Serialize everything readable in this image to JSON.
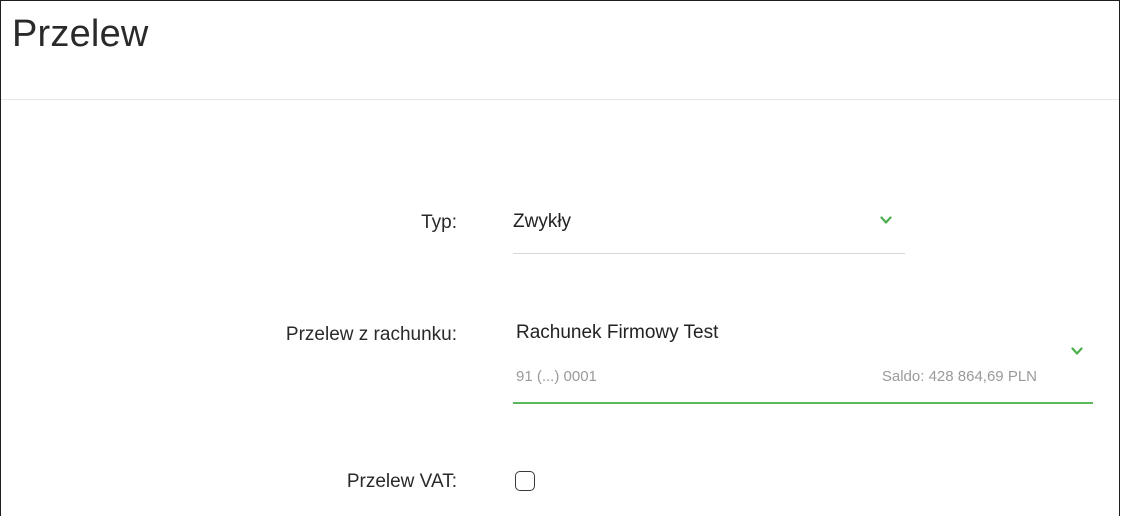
{
  "header": {
    "title": "Przelew"
  },
  "form": {
    "type": {
      "label": "Typ:",
      "value": "Zwykły",
      "chevron_icon": "chevron-down-icon"
    },
    "account": {
      "label": "Przelew z rachunku:",
      "name": "Rachunek Firmowy Test",
      "number": "91 (...) 0001",
      "balance": "Saldo: 428 864,69 PLN",
      "chevron_icon": "chevron-down-icon"
    },
    "vat": {
      "label": "Przelew VAT:",
      "checked": false
    }
  },
  "colors": {
    "accent": "#5cb85c",
    "text": "#222222",
    "muted": "#9a9a9a",
    "divider": "#d9d9d9"
  }
}
